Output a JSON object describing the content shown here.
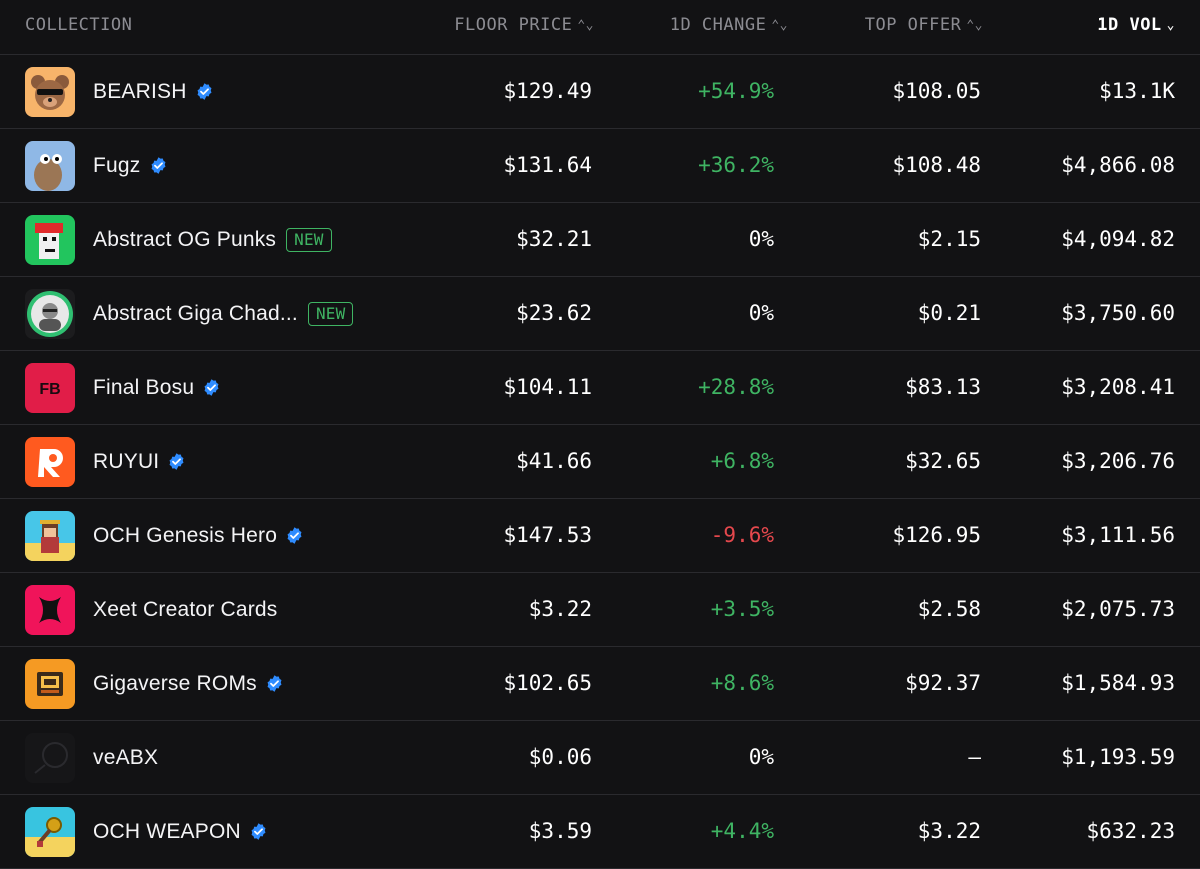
{
  "header": {
    "collection": "COLLECTION",
    "floor_price": "FLOOR PRICE",
    "change_1d": "1D CHANGE",
    "top_offer": "TOP OFFER",
    "vol_1d": "1D VOL",
    "sort_both_icon": "⌃⌄",
    "sort_desc_icon": "⌄"
  },
  "colors": {
    "positive": "#3fb463",
    "negative": "#e5484d",
    "verified": "#2f8cff",
    "background": "#121214"
  },
  "rows": [
    {
      "name": "BEARISH",
      "verified": true,
      "is_new": false,
      "floor": "$129.49",
      "change": "+54.9%",
      "change_dir": "pos",
      "offer": "$108.05",
      "vol": "$13.1K",
      "icon": "bear-avatar-icon"
    },
    {
      "name": "Fugz",
      "verified": true,
      "is_new": false,
      "floor": "$131.64",
      "change": "+36.2%",
      "change_dir": "pos",
      "offer": "$108.48",
      "vol": "$4,866.08",
      "icon": "fugz-avatar-icon"
    },
    {
      "name": "Abstract OG Punks",
      "verified": false,
      "is_new": true,
      "new_label": "NEW",
      "floor": "$32.21",
      "change": "0%",
      "change_dir": "neu",
      "offer": "$2.15",
      "vol": "$4,094.82",
      "icon": "punk-avatar-icon"
    },
    {
      "name": "Abstract Giga Chad...",
      "verified": false,
      "is_new": true,
      "new_label": "NEW",
      "floor": "$23.62",
      "change": "0%",
      "change_dir": "neu",
      "offer": "$0.21",
      "vol": "$3,750.60",
      "icon": "chad-avatar-icon"
    },
    {
      "name": "Final Bosu",
      "verified": true,
      "is_new": false,
      "floor": "$104.11",
      "change": "+28.8%",
      "change_dir": "pos",
      "offer": "$83.13",
      "vol": "$3,208.41",
      "icon": "fb-logo-icon"
    },
    {
      "name": "RUYUI",
      "verified": true,
      "is_new": false,
      "floor": "$41.66",
      "change": "+6.8%",
      "change_dir": "pos",
      "offer": "$32.65",
      "vol": "$3,206.76",
      "icon": "ruyui-logo-icon"
    },
    {
      "name": "OCH Genesis Hero",
      "verified": true,
      "is_new": false,
      "floor": "$147.53",
      "change": "-9.6%",
      "change_dir": "neg",
      "offer": "$126.95",
      "vol": "$3,111.56",
      "icon": "hero-avatar-icon"
    },
    {
      "name": "Xeet Creator Cards",
      "verified": false,
      "is_new": false,
      "floor": "$3.22",
      "change": "+3.5%",
      "change_dir": "pos",
      "offer": "$2.58",
      "vol": "$2,075.73",
      "icon": "xeet-logo-icon"
    },
    {
      "name": "Gigaverse ROMs",
      "verified": true,
      "is_new": false,
      "floor": "$102.65",
      "change": "+8.6%",
      "change_dir": "pos",
      "offer": "$92.37",
      "vol": "$1,584.93",
      "icon": "rom-chip-icon"
    },
    {
      "name": "veABX",
      "verified": false,
      "is_new": false,
      "floor": "$0.06",
      "change": "0%",
      "change_dir": "neu",
      "offer": "–",
      "vol": "$1,193.59",
      "icon": "veabx-logo-icon"
    },
    {
      "name": "OCH WEAPON",
      "verified": true,
      "is_new": false,
      "floor": "$3.59",
      "change": "+4.4%",
      "change_dir": "pos",
      "offer": "$3.22",
      "vol": "$632.23",
      "icon": "weapon-avatar-icon"
    }
  ]
}
